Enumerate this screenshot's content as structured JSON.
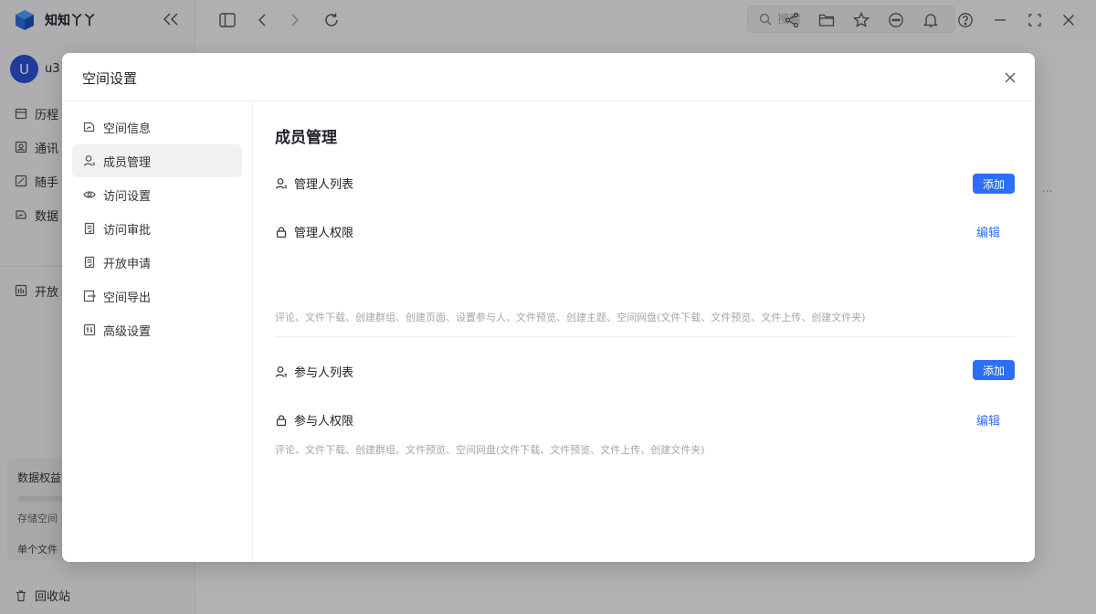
{
  "app": {
    "brand": "知知丫丫",
    "user_initial": "U",
    "user_name": "u3",
    "nav": [
      {
        "label": "历程",
        "icon": "calendar-icon"
      },
      {
        "label": "通讯",
        "icon": "contacts-icon"
      },
      {
        "label": "随手",
        "icon": "edit-icon"
      },
      {
        "label": "数据",
        "icon": "data-space-icon"
      },
      {
        "label": "开放",
        "icon": "open-icon"
      }
    ],
    "quota": {
      "title": "数据权益",
      "storage": "存储空间",
      "single_file": "单个文件"
    },
    "recycle": "回收站",
    "search_placeholder": "搜索",
    "ellipsis": "..."
  },
  "modal": {
    "title": "空间设置",
    "menu": [
      {
        "label": "空间信息",
        "icon": "space-info-icon"
      },
      {
        "label": "成员管理",
        "icon": "member-icon",
        "active": true
      },
      {
        "label": "访问设置",
        "icon": "eye-icon"
      },
      {
        "label": "访问审批",
        "icon": "approval-doc-icon"
      },
      {
        "label": "开放申请",
        "icon": "application-doc-icon"
      },
      {
        "label": "空间导出",
        "icon": "export-icon"
      },
      {
        "label": "高级设置",
        "icon": "advanced-settings-icon"
      }
    ],
    "content": {
      "title": "成员管理",
      "admin_list": "管理人列表",
      "admin_perm": "管理人权限",
      "admin_perm_desc": "评论、文件下载、创建群组、创建页面、设置参与人、文件预览、创建主题、空间网盘(文件下载、文件预览、文件上传、创建文件夹)",
      "participant_list": "参与人列表",
      "participant_perm": "参与人权限",
      "participant_perm_desc": "评论、文件下载、创建群组、文件预览、空间网盘(文件下载、文件预览、文件上传、创建文件夹)",
      "add_label": "添加",
      "edit_label": "编辑"
    }
  },
  "colors": {
    "accent": "#2b6ff6",
    "avatar": "#2b54d6"
  }
}
